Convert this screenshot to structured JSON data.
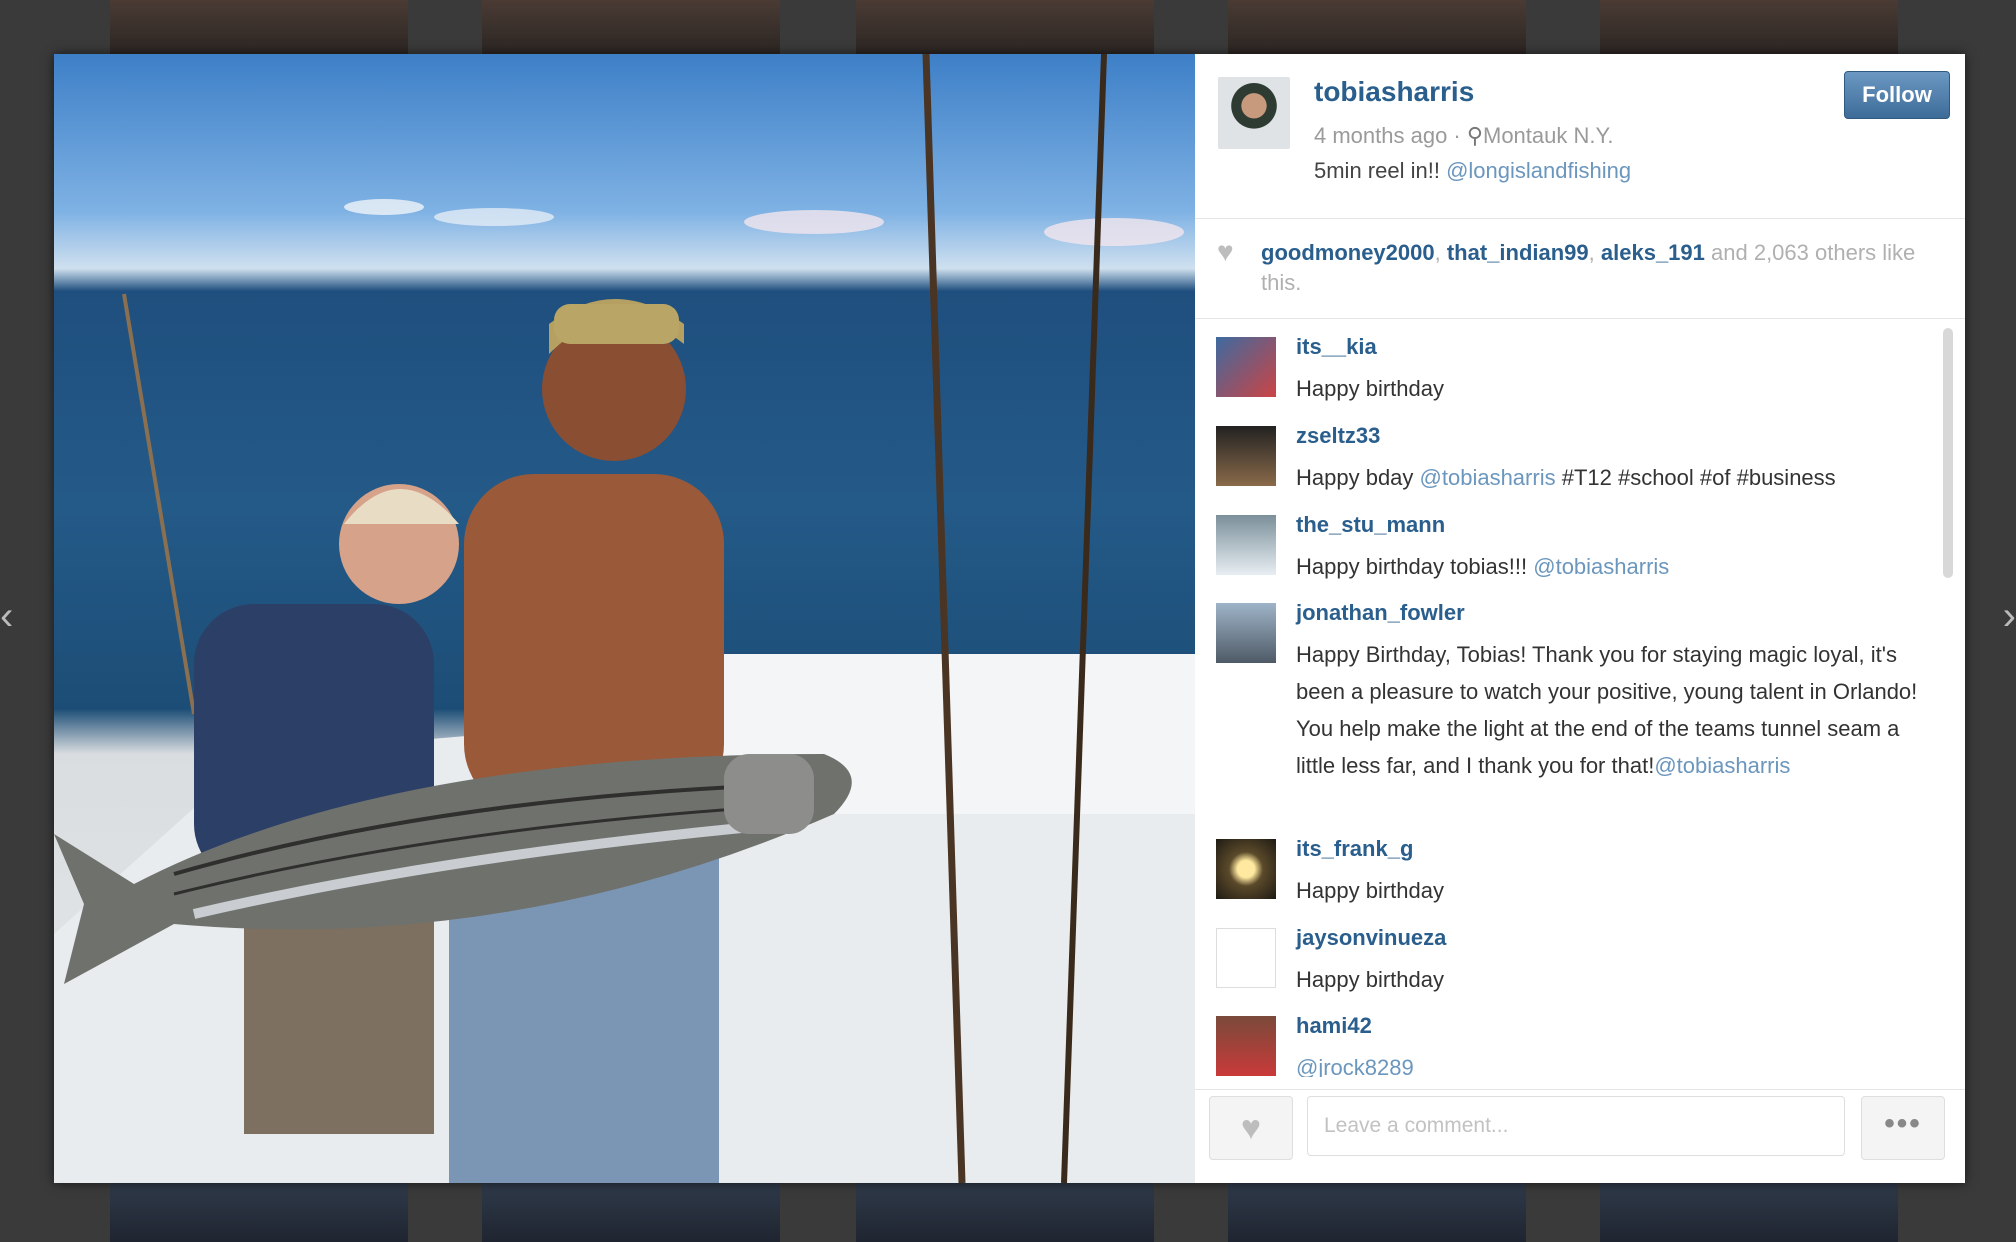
{
  "post": {
    "username": "tobiasharris",
    "time_ago": "4 months ago",
    "separator": " · ",
    "location": "Montauk N.Y.",
    "caption_text": "5min reel in!! ",
    "caption_mention": "@longislandfishing",
    "follow_label": "Follow"
  },
  "likes": {
    "user1": "goodmoney2000",
    "user2": "that_indian99",
    "user3": "aleks_191",
    "suffix": "and 2,063 others like this."
  },
  "comments": [
    {
      "user": "its__kia",
      "text": "Happy birthday",
      "mention": ""
    },
    {
      "user": "zseltz33",
      "text": "Happy bday ",
      "mention": "@tobiasharris",
      "text_after": " #T12 #school #of #business"
    },
    {
      "user": "the_stu_mann",
      "text": "Happy birthday tobias!!! ",
      "mention": "@tobiasharris"
    },
    {
      "user": "jonathan_fowler",
      "text": "Happy Birthday, Tobias! Thank you for staying magic loyal, it's been a pleasure to watch your positive, young talent in Orlando! You help make the light at the end of the teams tunnel seam a little less far, and I thank you for that!",
      "mention": "@tobiasharris"
    },
    {
      "user": "its_frank_g",
      "text": "Happy birthday",
      "mention": ""
    },
    {
      "user": "jaysonvinueza",
      "text": "Happy birthday",
      "mention": ""
    },
    {
      "user": "hami42",
      "text": "",
      "mention": "@jrock8289"
    }
  ],
  "footer": {
    "comment_placeholder": "Leave a comment...",
    "more_label": "•••",
    "heart_icon": "♥"
  },
  "icons": {
    "location": "pin-icon",
    "like": "heart-icon"
  }
}
